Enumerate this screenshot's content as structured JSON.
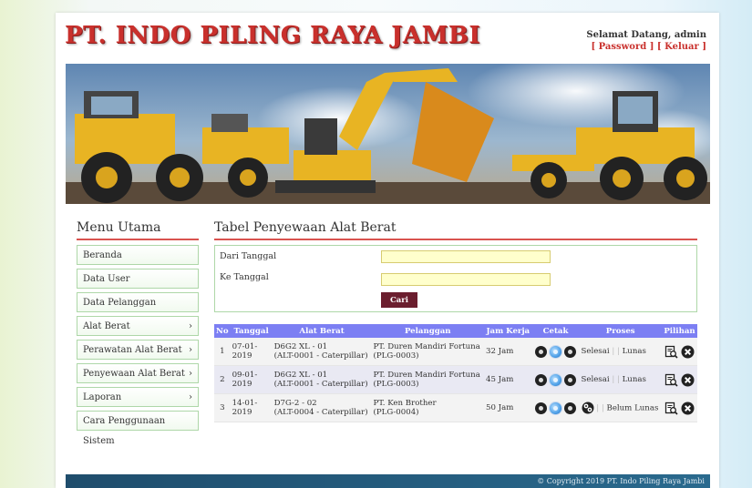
{
  "header": {
    "site_title": "PT. INDO PILING RAYA JAMBI",
    "welcome": "Selamat Datang, admin",
    "password_link": "[ Password ]",
    "logout_link": "[ Keluar ]"
  },
  "sidebar": {
    "title": "Menu Utama",
    "items": [
      {
        "label": "Beranda",
        "has_arrow": false
      },
      {
        "label": "Data User",
        "has_arrow": false
      },
      {
        "label": "Data Pelanggan",
        "has_arrow": false
      },
      {
        "label": "Alat Berat",
        "has_arrow": true
      },
      {
        "label": "Perawatan Alat Berat",
        "has_arrow": true
      },
      {
        "label": "Penyewaan Alat Berat",
        "has_arrow": true
      },
      {
        "label": "Laporan",
        "has_arrow": true
      },
      {
        "label": "Cara Penggunaan Sistem",
        "has_arrow": false
      }
    ]
  },
  "main": {
    "title": "Tabel Penyewaan Alat Berat",
    "filter": {
      "from_label": "Dari Tanggal",
      "to_label": "Ke Tanggal",
      "from_value": "",
      "to_value": "",
      "search_button": "Cari"
    },
    "table": {
      "headers": [
        "No",
        "Tanggal",
        "Alat Berat",
        "Pelanggan",
        "Jam Kerja",
        "Cetak",
        "Proses",
        "Pilihan"
      ],
      "rows": [
        {
          "no": "1",
          "tanggal": "07-01-2019",
          "alat_line1": "D6G2 XL - 01",
          "alat_line2": "(ALT-0001 - Caterpillar)",
          "pel_line1": "PT. Duren Mandiri Fortuna",
          "pel_line2": "(PLG-0003)",
          "jam": "32 Jam",
          "status1": "Selesai",
          "status2": "Lunas",
          "show_process_icon": false
        },
        {
          "no": "2",
          "tanggal": "09-01-2019",
          "alat_line1": "D6G2 XL - 01",
          "alat_line2": "(ALT-0001 - Caterpillar)",
          "pel_line1": "PT. Duren Mandiri Fortuna",
          "pel_line2": "(PLG-0003)",
          "jam": "45 Jam",
          "status1": "Selesai",
          "status2": "Lunas",
          "show_process_icon": false
        },
        {
          "no": "3",
          "tanggal": "14-01-2019",
          "alat_line1": "D7G-2 - 02",
          "alat_line2": "(ALT-0004 - Caterpillar)",
          "pel_line1": "PT. Ken Brother",
          "pel_line2": "(PLG-0004)",
          "jam": "50 Jam",
          "status1": "",
          "status2": "Belum Lunas",
          "show_process_icon": true
        }
      ],
      "status_separator": "| |"
    }
  },
  "footer": {
    "copyright": "© Copyright 2019 PT. Indo Piling Raya Jambi"
  },
  "colors": {
    "title_red": "#c9302c",
    "table_header": "#7c7ff3",
    "button": "#6b1e2e",
    "menu_border": "#aed7a8"
  }
}
